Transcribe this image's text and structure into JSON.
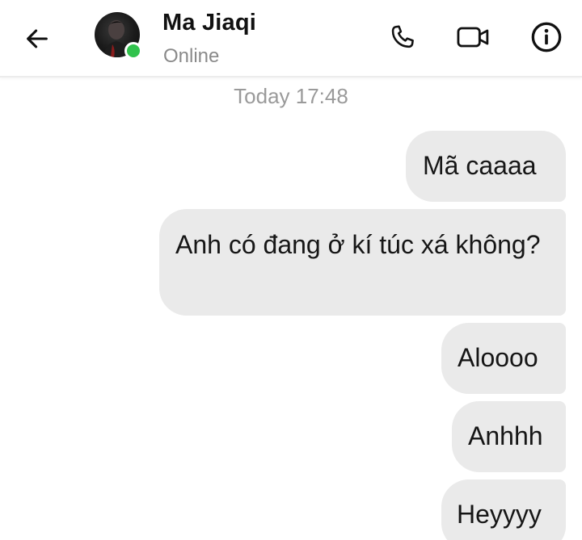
{
  "header": {
    "contact_name": "Ma Jiaqi",
    "status": "Online",
    "presence_color": "#31c24d",
    "icons": {
      "back": "back-arrow-icon",
      "call": "phone-icon",
      "video": "video-camera-icon",
      "info": "info-icon"
    }
  },
  "conversation": {
    "timestamp": "Today 17:48",
    "messages": [
      {
        "text": "Mã caaaa",
        "sender": "me"
      },
      {
        "text": "Anh có đang ở kí túc xá không?",
        "sender": "me"
      },
      {
        "text": "Aloooo",
        "sender": "me"
      },
      {
        "text": "Anhhh",
        "sender": "me"
      },
      {
        "text": "Heyyyy",
        "sender": "me"
      }
    ],
    "bubble_color": "#eaeaea"
  }
}
